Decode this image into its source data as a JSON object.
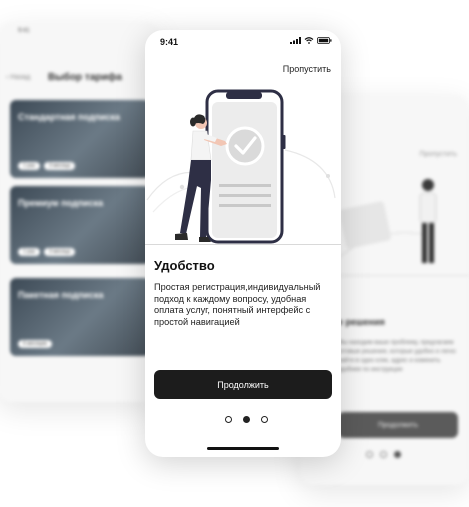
{
  "left_screen": {
    "status_time": "9:41",
    "back_label": "Назад",
    "title": "Выбор тарифа",
    "cards": [
      {
        "title": "Стандартная подписка",
        "chips": [
          "1 раз",
          "3 месяца"
        ]
      },
      {
        "title": "Премиум подписка",
        "chips": [
          "1 раз",
          "3 месяца"
        ]
      },
      {
        "title": "Пакетная подписка",
        "chips": [
          "6 месяцев"
        ]
      }
    ]
  },
  "right_screen": {
    "skip_label": "Пропустить",
    "title": "е решения",
    "text": "Мы находим ваше проблему, предлагаем готовые решения, которые удобно и легко найти в одно клик, адрес и изменить удобнее по инструкции",
    "button_label": "Продолжить"
  },
  "main": {
    "status_time": "9:41",
    "skip_label": "Пропустить",
    "title": "Удобство",
    "description": "Простая регистрация,индивидуальный подход к каждому вопросу, удобная оплата услуг, понятный интерфейс с простой навигацией",
    "continue_label": "Продолжить",
    "pagination": {
      "total": 3,
      "active": 2
    }
  },
  "colors": {
    "button_bg": "#1c1c1c",
    "accent_pants": "#2e2f45"
  }
}
